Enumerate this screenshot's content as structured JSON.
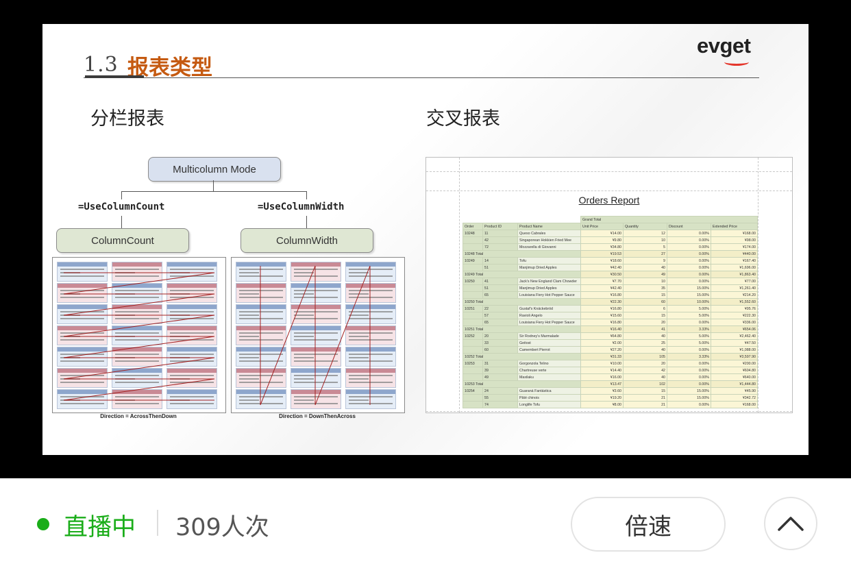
{
  "slide": {
    "section_number": "1.3",
    "section_title": "报表类型",
    "logo": "evget",
    "left_heading": "分栏报表",
    "right_heading": "交叉报表",
    "diagram": {
      "root": "Multicolumn Mode",
      "left_edge": "=UseColumnCount",
      "right_edge": "=UseColumnWidth",
      "left_node": "ColumnCount",
      "right_node": "ColumnWidth",
      "left_caption": "Direction = AcrossThenDown",
      "right_caption": "Direction = DownThenAcross"
    },
    "crosstab": {
      "title": "Orders Report",
      "group_header": "Grand Total",
      "columns": [
        "Order",
        "Product ID",
        "Product Name",
        "Unit Price",
        "Quantity",
        "Discount",
        "Extended Price"
      ],
      "rows": [
        [
          "10248",
          "11",
          "Queso Cabrales",
          "¥14.00",
          "12",
          "0.00%",
          "¥168.00"
        ],
        [
          "",
          "42",
          "Singaporean Hokkien Fried Mee",
          "¥9.80",
          "10",
          "0.00%",
          "¥98.00"
        ],
        [
          "",
          "72",
          "Mozzarella di Giovanni",
          "¥34.80",
          "5",
          "0.00%",
          "¥174.00"
        ],
        [
          "10248 Total",
          "",
          "",
          "¥19.53",
          "27",
          "0.00%",
          "¥440.00"
        ],
        [
          "10249",
          "14",
          "Tofu",
          "¥18.60",
          "9",
          "0.00%",
          "¥167.40"
        ],
        [
          "",
          "51",
          "Manjimup Dried Apples",
          "¥42.40",
          "40",
          "0.00%",
          "¥1,696.00"
        ],
        [
          "10249 Total",
          "",
          "",
          "¥30.50",
          "49",
          "0.00%",
          "¥1,863.40"
        ],
        [
          "10250",
          "41",
          "Jack's New England Clam Chowder",
          "¥7.70",
          "10",
          "0.00%",
          "¥77.00"
        ],
        [
          "",
          "51",
          "Manjimup Dried Apples",
          "¥42.40",
          "35",
          "15.00%",
          "¥1,261.40"
        ],
        [
          "",
          "65",
          "Louisiana Fiery Hot Pepper Sauce",
          "¥16.80",
          "15",
          "15.00%",
          "¥214.20"
        ],
        [
          "10250 Total",
          "",
          "",
          "¥22.30",
          "60",
          "10.00%",
          "¥1,552.60"
        ],
        [
          "10251",
          "22",
          "Gustaf's Knäckebröd",
          "¥16.80",
          "6",
          "5.00%",
          "¥95.76"
        ],
        [
          "",
          "57",
          "Ravioli Angelo",
          "¥15.60",
          "15",
          "5.00%",
          "¥222.30"
        ],
        [
          "",
          "65",
          "Louisiana Fiery Hot Pepper Sauce",
          "¥16.80",
          "20",
          "0.00%",
          "¥336.00"
        ],
        [
          "10251 Total",
          "",
          "",
          "¥16.40",
          "41",
          "3.33%",
          "¥654.06"
        ],
        [
          "10252",
          "20",
          "Sir Rodney's Marmalade",
          "¥64.80",
          "40",
          "5.00%",
          "¥2,462.40"
        ],
        [
          "",
          "33",
          "Geitost",
          "¥2.00",
          "25",
          "5.00%",
          "¥47.50"
        ],
        [
          "",
          "60",
          "Camembert Pierrot",
          "¥27.20",
          "40",
          "0.00%",
          "¥1,088.00"
        ],
        [
          "10252 Total",
          "",
          "",
          "¥31.33",
          "105",
          "3.33%",
          "¥3,597.90"
        ],
        [
          "10253",
          "31",
          "Gorgonzola Telino",
          "¥10.00",
          "20",
          "0.00%",
          "¥200.00"
        ],
        [
          "",
          "39",
          "Chartreuse verte",
          "¥14.40",
          "42",
          "0.00%",
          "¥604.80"
        ],
        [
          "",
          "49",
          "Maxilaku",
          "¥16.00",
          "40",
          "0.00%",
          "¥640.00"
        ],
        [
          "10253 Total",
          "",
          "",
          "¥13.47",
          "102",
          "0.00%",
          "¥1,444.80"
        ],
        [
          "10254",
          "24",
          "Guaraná Fantástica",
          "¥3.60",
          "15",
          "15.00%",
          "¥45.90"
        ],
        [
          "",
          "55",
          "Pâté chinois",
          "¥19.20",
          "21",
          "15.00%",
          "¥342.72"
        ],
        [
          "",
          "74",
          "Longlife Tofu",
          "¥8.00",
          "21",
          "0.00%",
          "¥168.00"
        ]
      ]
    }
  },
  "bottom_bar": {
    "live_label": "直播中",
    "viewers": "309人次",
    "speed_label": "倍速",
    "expand_icon": "chevron-up-icon",
    "live_color": "#1aad19"
  }
}
